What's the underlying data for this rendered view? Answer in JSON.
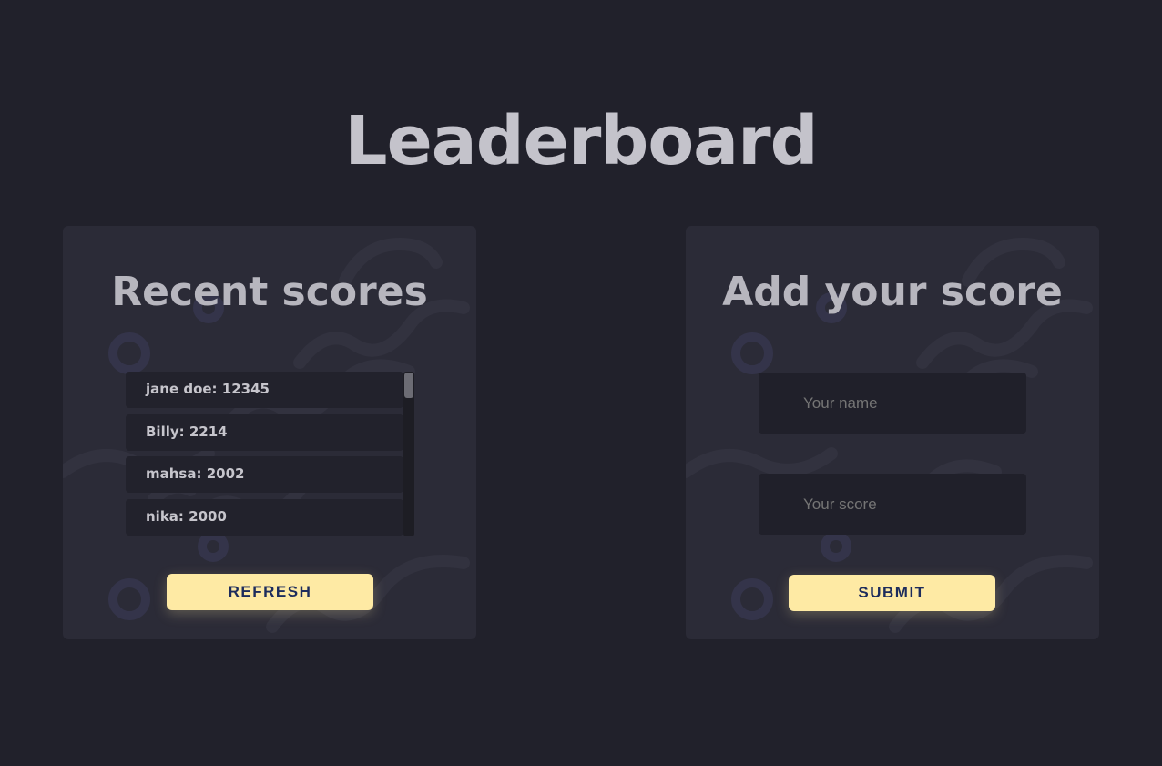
{
  "header": {
    "title": "Leaderboard"
  },
  "recent": {
    "title": "Recent scores",
    "scores": [
      {
        "label": "jane doe: 12345"
      },
      {
        "label": "Billy: 2214"
      },
      {
        "label": "mahsa: 2002"
      },
      {
        "label": "nika: 2000"
      }
    ],
    "refresh_label": "REFRESH"
  },
  "add": {
    "title": "Add your score",
    "name_placeholder": "Your name",
    "score_placeholder": "Your score",
    "submit_label": "SUBMIT"
  },
  "colors": {
    "background": "#21212b",
    "panel": "#2b2b37",
    "button": "#feeaa4",
    "button_text": "#1d2c5c",
    "title_text": "#c4c3cb"
  }
}
